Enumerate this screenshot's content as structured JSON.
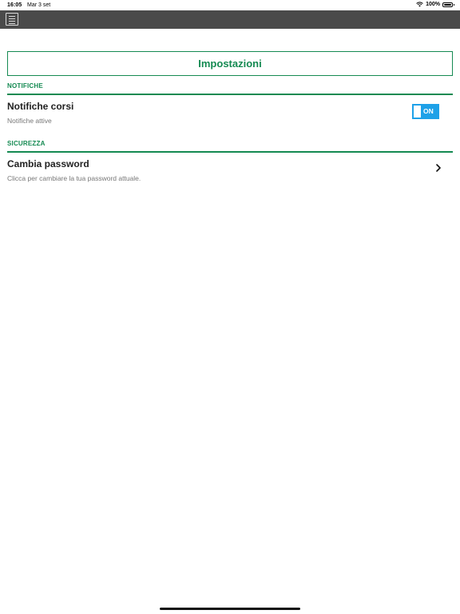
{
  "status_bar": {
    "time": "16:05",
    "date": "Mar 3 set",
    "battery": "100%",
    "icons": [
      "wifi-icon",
      "battery-icon"
    ]
  },
  "app_bar": {
    "menu_icon": "hamburger-menu-icon",
    "background": "#4a4a4a"
  },
  "page": {
    "title": "Impostazioni",
    "accent_color": "#158a52"
  },
  "sections": [
    {
      "title": "NOTIFICHE",
      "items": [
        {
          "title": "Notifiche corsi",
          "subtitle": "Notifiche attive",
          "control": "toggle",
          "toggle_label": "ON",
          "toggle_on": true,
          "toggle_color": "#1ea1e8"
        }
      ]
    },
    {
      "title": "SICUREZZA",
      "items": [
        {
          "title": "Cambia password",
          "subtitle": "Clicca per cambiare la tua password attuale.",
          "control": "chevron",
          "chevron_icon": "chevron-right-icon"
        }
      ]
    }
  ]
}
